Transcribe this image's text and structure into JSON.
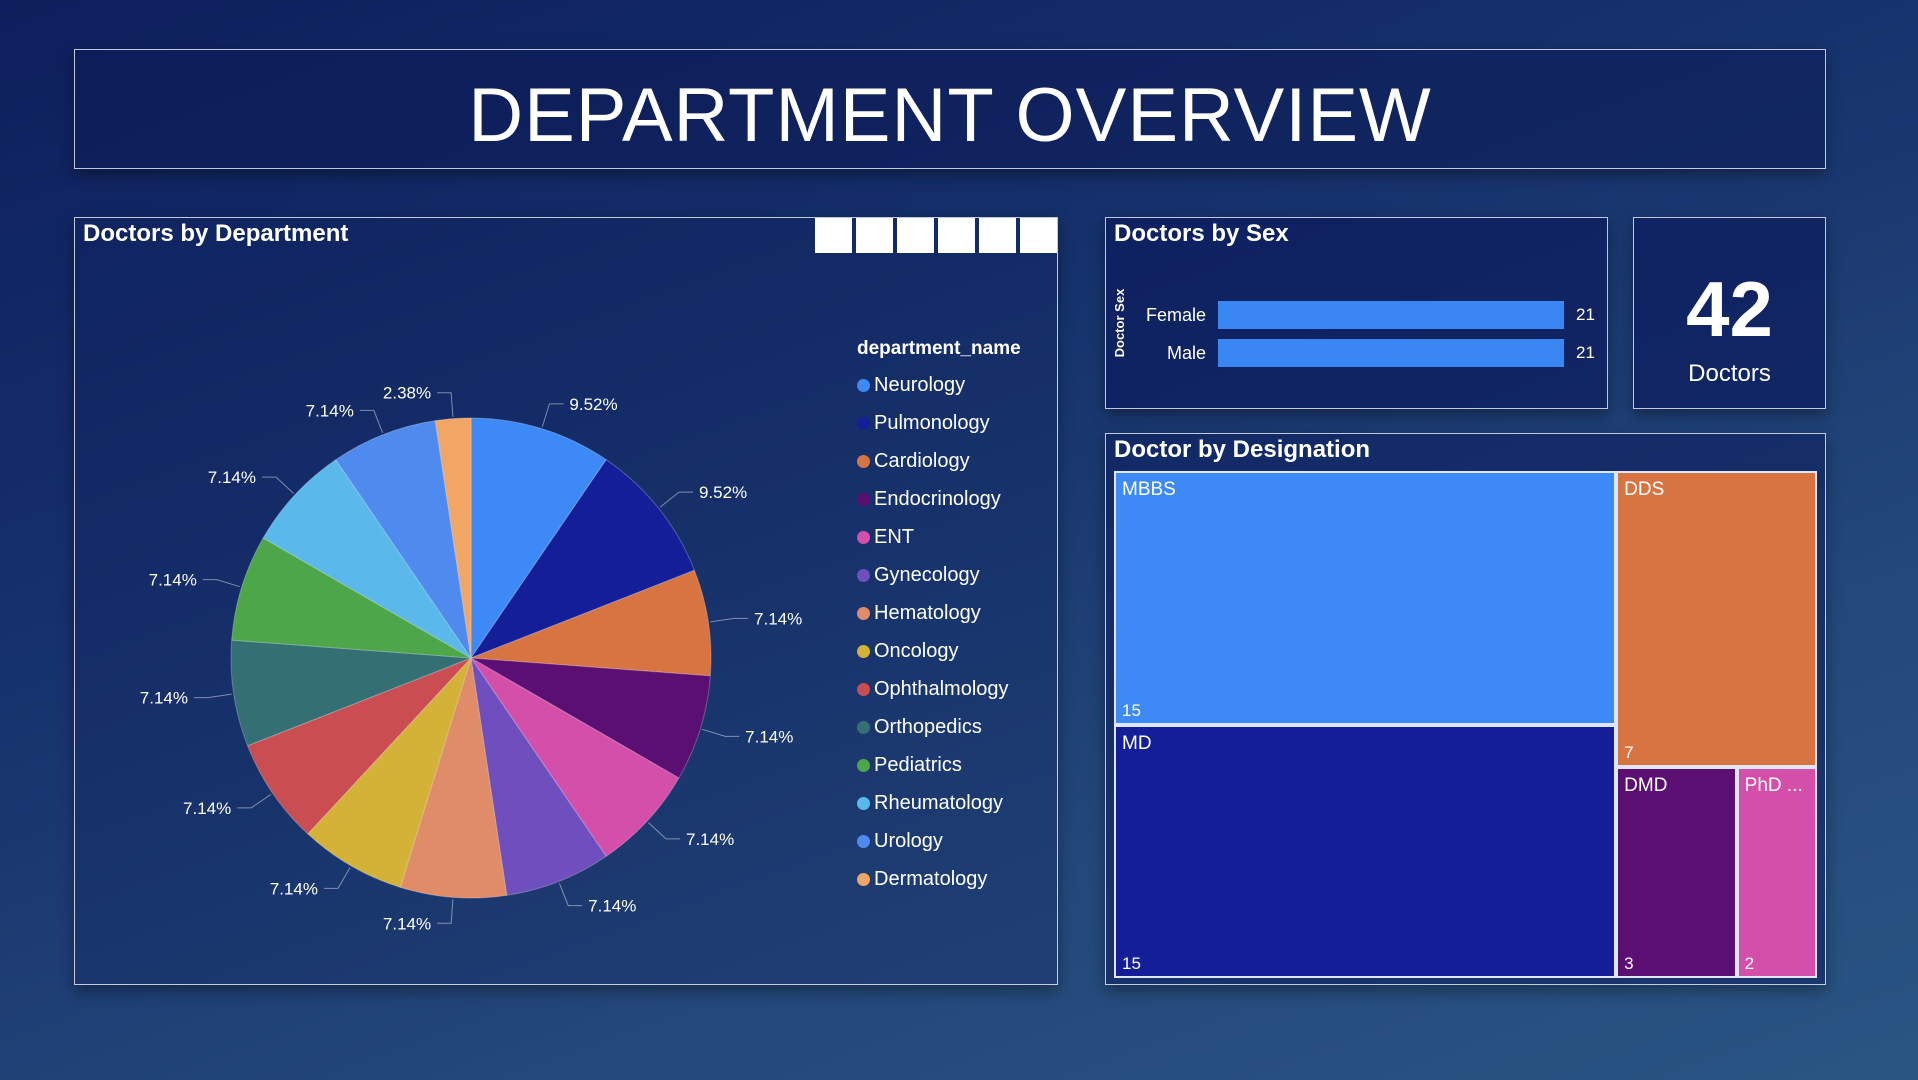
{
  "page": {
    "title": "DEPARTMENT OVERVIEW"
  },
  "toolbar": {
    "buttons": [
      "",
      "",
      "",
      "",
      "",
      ""
    ]
  },
  "department_chart": {
    "title": "Doctors by Department",
    "legend_title": "department_name"
  },
  "sex_chart": {
    "title": "Doctors by Sex",
    "axis_label": "Doctor Sex"
  },
  "kpi": {
    "value": "42",
    "label": "Doctors"
  },
  "designation_chart": {
    "title": "Doctor by Designation"
  },
  "chart_data": [
    {
      "type": "pie",
      "title": "Doctors by Department",
      "legend_title": "department_name",
      "legend_position": "right",
      "slices": [
        {
          "name": "Neurology",
          "value": 9.52,
          "label": "9.52%",
          "color": "#3d89f5"
        },
        {
          "name": "Pulmonology",
          "value": 9.52,
          "label": "9.52%",
          "color": "#141e98"
        },
        {
          "name": "Cardiology",
          "value": 7.14,
          "label": "7.14%",
          "color": "#d77442"
        },
        {
          "name": "Endocrinology",
          "value": 7.14,
          "label": "7.14%",
          "color": "#5c0f72"
        },
        {
          "name": "ENT",
          "value": 7.14,
          "label": "7.14%",
          "color": "#d44fa9"
        },
        {
          "name": "Gynecology",
          "value": 7.14,
          "label": "7.14%",
          "color": "#6f4fbe"
        },
        {
          "name": "Hematology",
          "value": 7.14,
          "label": "7.14%",
          "color": "#e08c68"
        },
        {
          "name": "Oncology",
          "value": 7.14,
          "label": "7.14%",
          "color": "#d4b237"
        },
        {
          "name": "Ophthalmology",
          "value": 7.14,
          "label": "7.14%",
          "color": "#c94d51"
        },
        {
          "name": "Orthopedics",
          "value": 7.14,
          "label": "7.14%",
          "color": "#336f73"
        },
        {
          "name": "Pediatrics",
          "value": 7.14,
          "label": "7.14%",
          "color": "#4ea64a"
        },
        {
          "name": "Rheumatology",
          "value": 7.14,
          "label": "7.14%",
          "color": "#5ab9ea"
        },
        {
          "name": "Urology",
          "value": 7.14,
          "label": "7.14%",
          "color": "#4f8bef"
        },
        {
          "name": "Dermatology",
          "value": 2.38,
          "label": "2.38%",
          "color": "#f2a665"
        }
      ]
    },
    {
      "type": "bar",
      "orientation": "horizontal",
      "title": "Doctors by Sex",
      "ylabel": "Doctor Sex",
      "categories": [
        "Female",
        "Male"
      ],
      "values": [
        21,
        21
      ],
      "color": "#3a86f2"
    },
    {
      "type": "treemap",
      "title": "Doctor by Designation",
      "items": [
        {
          "name": "MBBS",
          "value": 15,
          "color": "#3d89f5"
        },
        {
          "name": "MD",
          "value": 15,
          "color": "#141e98"
        },
        {
          "name": "DDS",
          "value": 7,
          "color": "#d77442"
        },
        {
          "name": "DMD",
          "value": 3,
          "color": "#5c0f72"
        },
        {
          "name": "PhD ...",
          "value": 2,
          "color": "#d44fa9"
        }
      ]
    }
  ]
}
